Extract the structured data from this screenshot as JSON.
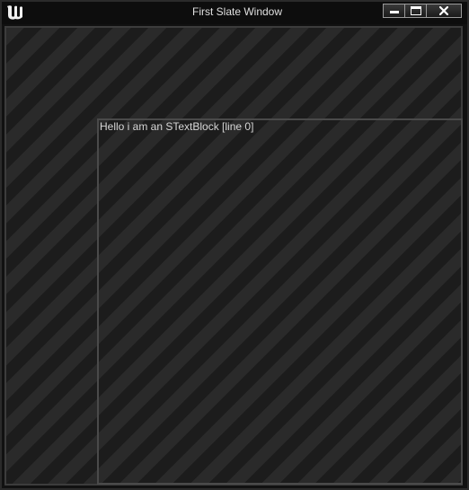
{
  "window": {
    "title": "First Slate Window",
    "logo_icon": "unreal-engine-logo-icon",
    "controls": {
      "minimize_icon": "minimize-icon",
      "maximize_icon": "maximize-icon",
      "close_icon": "close-icon"
    }
  },
  "content": {
    "text_block": "Hello i am an STextBlock [line 0]"
  }
}
